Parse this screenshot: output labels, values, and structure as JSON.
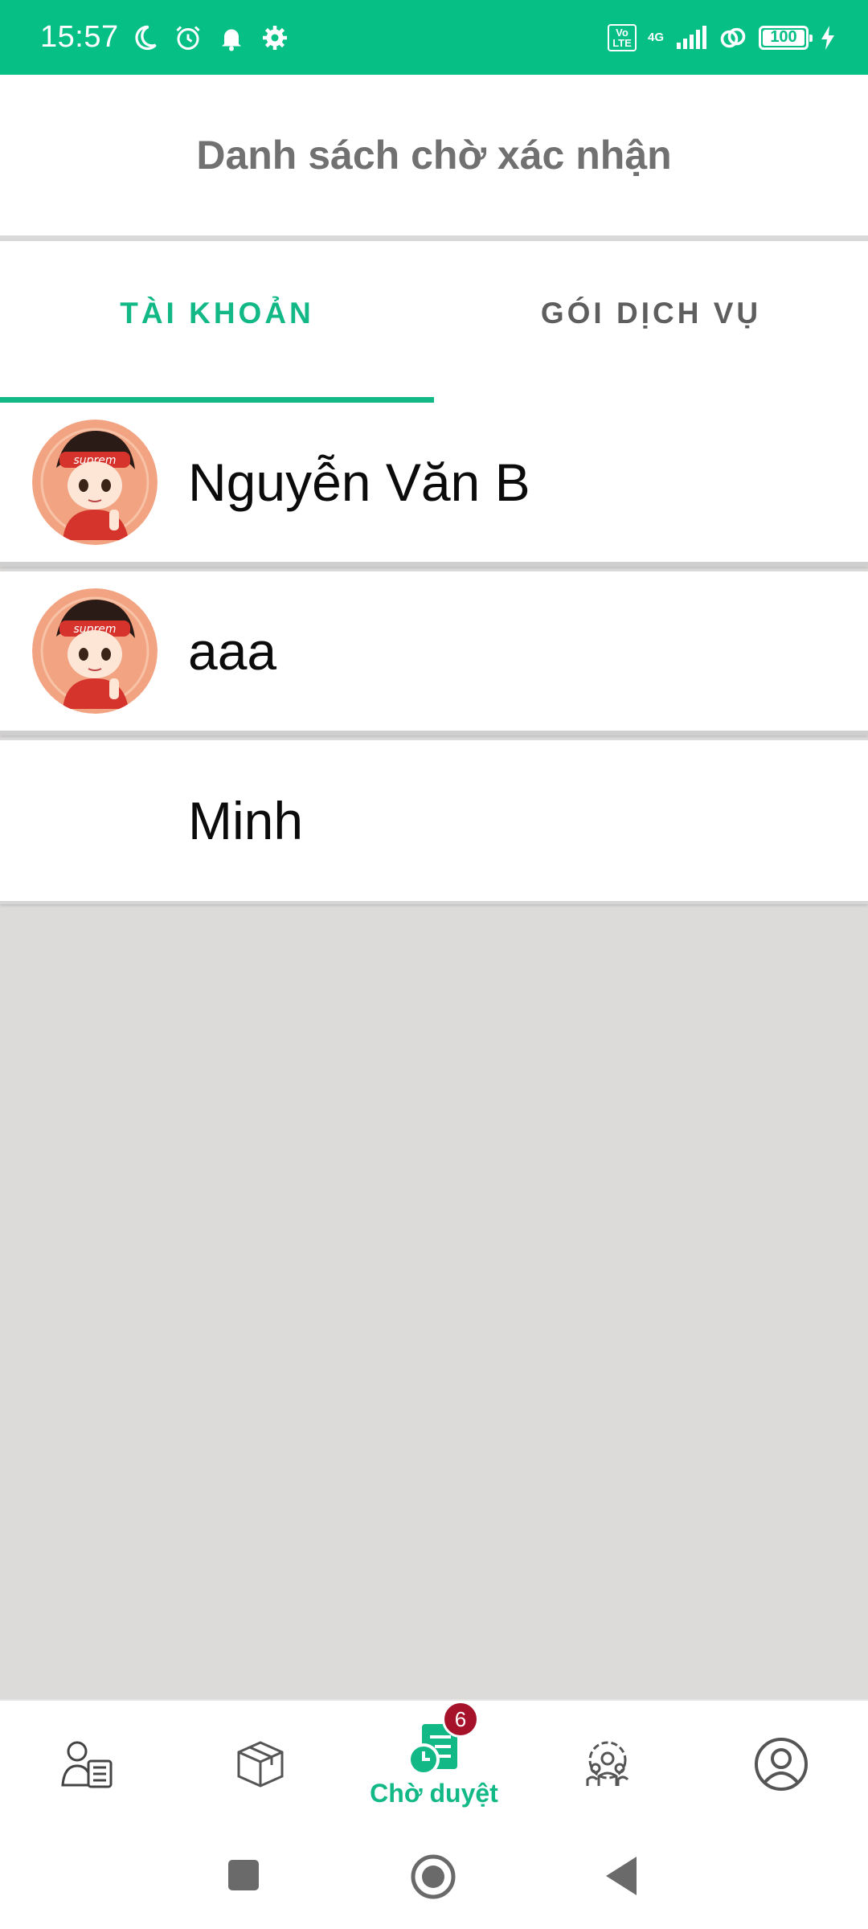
{
  "status_bar": {
    "time": "15:57",
    "volte": "Vo LTE",
    "network": "4G",
    "battery": "100",
    "left_icons": [
      "moon-icon",
      "alarm-icon",
      "bell-icon",
      "gear-icon"
    ],
    "right_icons": [
      "volte-icon",
      "signal-icon",
      "hotspot-icon",
      "battery-icon",
      "charging-icon"
    ]
  },
  "header": {
    "title": "Danh sách chờ xác nhận"
  },
  "tabs": [
    {
      "label": "TÀI KHOẢN",
      "active": true
    },
    {
      "label": "GÓI DỊCH VỤ",
      "active": false
    }
  ],
  "list": {
    "items": [
      {
        "name": "Nguyễn Văn B",
        "has_avatar": true
      },
      {
        "name": "aaa",
        "has_avatar": true
      },
      {
        "name": "Minh",
        "has_avatar": false
      }
    ]
  },
  "bottom_nav": {
    "items": [
      {
        "icon": "staff-list-icon",
        "label": ""
      },
      {
        "icon": "package-icon",
        "label": ""
      },
      {
        "icon": "pending-approval-icon",
        "label": "Chờ duyệt",
        "badge": "6",
        "active": true
      },
      {
        "icon": "group-settings-icon",
        "label": ""
      },
      {
        "icon": "profile-icon",
        "label": ""
      }
    ]
  },
  "system_nav": {
    "buttons": [
      "recents-button",
      "home-button",
      "back-button"
    ]
  },
  "colors": {
    "accent": "#12b886",
    "status_bar": "#05bf85",
    "badge": "#a6122a",
    "background": "#dcdbda"
  }
}
